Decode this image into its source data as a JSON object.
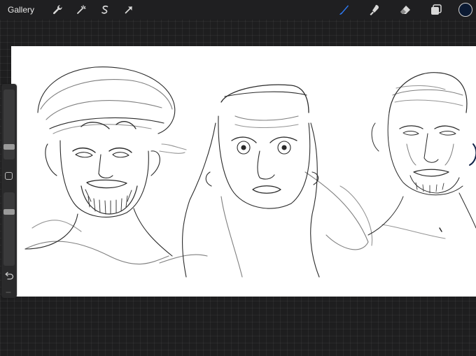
{
  "topbar": {
    "gallery_label": "Gallery",
    "left_tools": [
      "wrench-icon",
      "magic-wand-icon",
      "selection-icon",
      "transform-arrow-icon"
    ],
    "right_tools": [
      "brush-icon",
      "smudge-icon",
      "eraser-icon",
      "layers-icon"
    ],
    "brush_active_color": "#2e7bf6",
    "current_color": "#0b1a33"
  },
  "sidebar": {
    "brush_size_level": 0.75,
    "opacity_level": 0.28
  }
}
